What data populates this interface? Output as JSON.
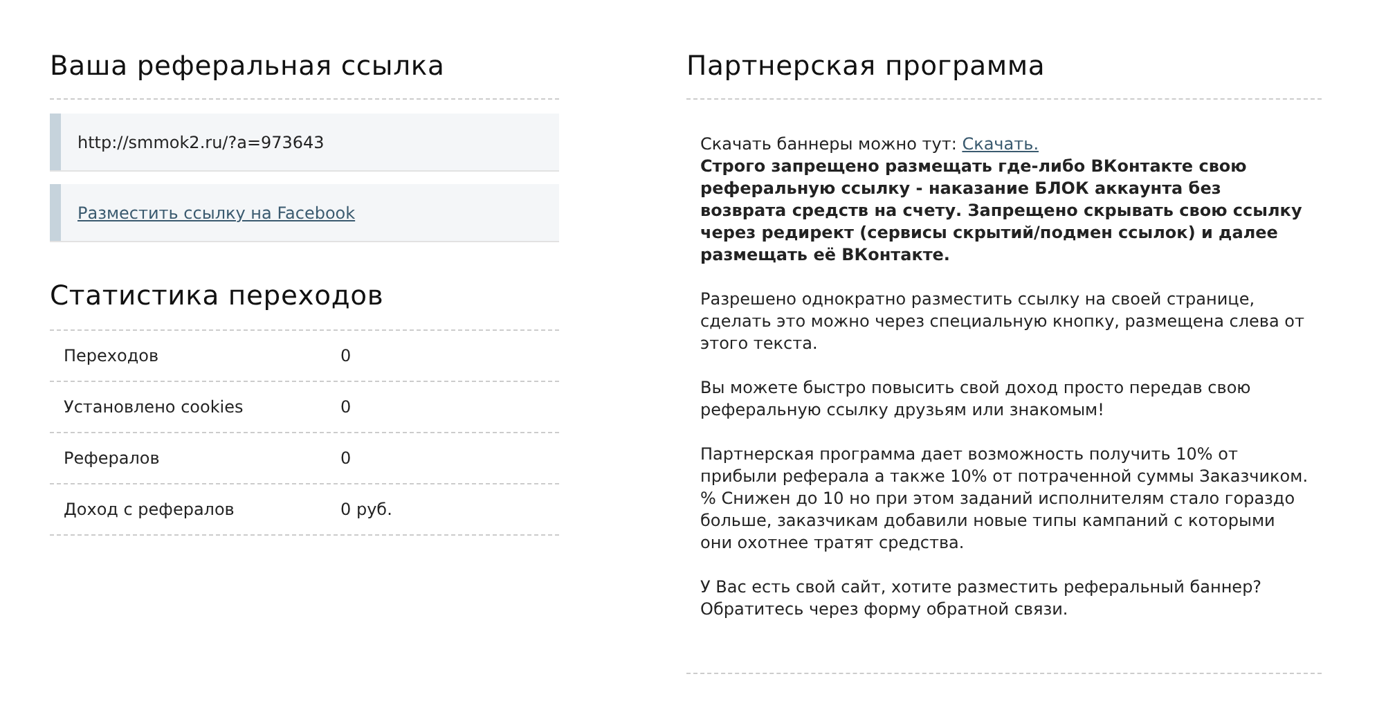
{
  "referral": {
    "title": "Ваша реферальная ссылка",
    "link_value": "http://smmok2.ru/?a=973643",
    "facebook_link": "Разместить ссылку на Facebook"
  },
  "stats": {
    "title": "Статистика переходов",
    "rows": [
      {
        "label": "Переходов",
        "value": "0"
      },
      {
        "label": "Установлено cookies",
        "value": "0"
      },
      {
        "label": "Рефералов",
        "value": "0"
      },
      {
        "label": "Доход с рефералов",
        "value": "0 руб."
      }
    ]
  },
  "partner": {
    "title": "Партнерская программа",
    "download_text": "Скачать баннеры можно тут:",
    "download_link": "Скачать.",
    "warning": "Строго запрещено размещать где-либо ВКонтакте свою реферальную ссылку - наказание БЛОК аккаунта без возврата средств на счету. Запрещено скрывать свою ссылку через редирект (сервисы скрытий/подмен ссылок) и далее размещать её ВКонтакте.",
    "paragraphs": [
      "Разрешено однократно разместить ссылку на своей странице, сделать это можно через специальную кнопку, размещена слева от этого текста.",
      "Вы можете быстро повысить свой доход просто передав свою реферальную ссылку друзьям или знакомым!",
      "Партнерская программа дает возможность получить 10% от прибыли реферала а также 10% от потраченной суммы Заказчиком. % Снижен до 10 но при этом заданий исполнителям стало гораздо больше, заказчикам добавили новые типы кампаний с которыми они охотнее тратят средства.",
      "У Вас есть свой сайт, хотите разместить реферальный баннер? Обратитесь через форму обратной связи."
    ]
  }
}
